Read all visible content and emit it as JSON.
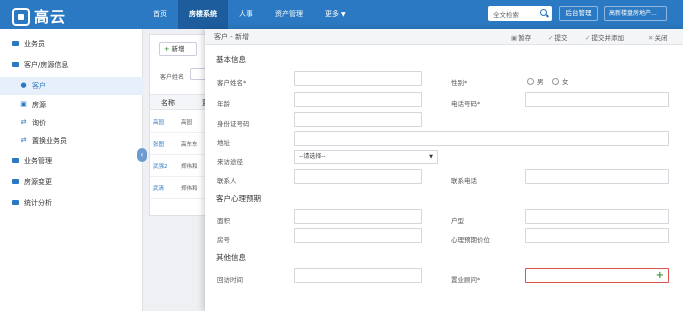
{
  "app": {
    "logo_text": "高云"
  },
  "nav": {
    "items": [
      "首页",
      "房楼系统",
      "人事",
      "资产管理",
      "更多"
    ]
  },
  "header": {
    "search_placeholder": "全文检索",
    "admin_label": "后台管理",
    "user_label": "高新楼盘房地产..."
  },
  "sidebar": {
    "items": [
      "业务员",
      "客户/房源信息",
      "客户",
      "房源",
      "询价",
      "置换业务员",
      "业务管理",
      "房源变更",
      "统计分析"
    ]
  },
  "list_panel": {
    "add_label": "新增",
    "filter_label": "客户姓名",
    "columns": [
      "名称",
      "置"
    ],
    "rows": [
      [
        "高园",
        "高园"
      ],
      [
        "张图",
        "高东东"
      ],
      [
        "武强2",
        "郑伟和"
      ],
      [
        "武清",
        "郑伟和"
      ]
    ]
  },
  "modal": {
    "title": "客户 - 新增",
    "buttons": {
      "draft": "暂存",
      "submit": "提交",
      "submit_add": "提交并添加",
      "close": "关闭"
    },
    "sections": {
      "basic": "基本信息",
      "psych": "客户心理预期",
      "other": "其他信息"
    },
    "labels": {
      "name": "客户姓名*",
      "gender": "性别*",
      "age": "年龄",
      "phone": "电话号码*",
      "id_number": "身份证号码",
      "address": "地址",
      "source": "来访途径",
      "contact": "联系人",
      "contact_phone": "联系电话",
      "area": "面积",
      "layout": "户型",
      "room_no": "房号",
      "expected_price": "心理预期价位",
      "visit_time": "回访时间",
      "consultant": "置业顾问*"
    },
    "gender_options": [
      "男",
      "女"
    ],
    "source_value": "--请选择--"
  }
}
